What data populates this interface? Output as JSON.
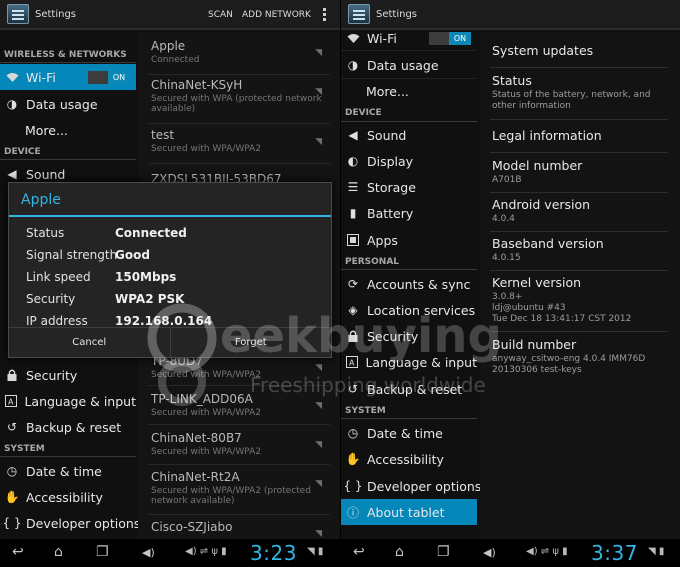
{
  "left": {
    "title": "Settings",
    "actions": {
      "scan": "SCAN",
      "add_network": "ADD NETWORK"
    },
    "categories": {
      "wireless": "WIRELESS & NETWORKS",
      "device": "DEVICE",
      "system": "SYSTEM"
    },
    "wifi_label": "Wi-Fi",
    "wifi_state": "ON",
    "items": {
      "data_usage": "Data usage",
      "more": "More...",
      "sound": "Sound",
      "security": "Security",
      "language": "Language & input",
      "backup": "Backup & reset",
      "datetime": "Date & time",
      "accessibility": "Accessibility",
      "developer": "Developer options"
    },
    "networks": [
      {
        "name": "Apple",
        "status": "Connected"
      },
      {
        "name": "ChinaNet-KSyH",
        "status": "Secured with WPA (protected network available)"
      },
      {
        "name": "test",
        "status": "Secured with WPA/WPA2"
      },
      {
        "name": "ZXDSL531BII-53BD67",
        "status": ""
      },
      {
        "name": "TP-8UD7",
        "status": "Secured with WPA/WPA2"
      },
      {
        "name": "TP-LINK_ADD06A",
        "status": "Secured with WPA/WPA2"
      },
      {
        "name": "ChinaNet-80B7",
        "status": "Secured with WPA/WPA2"
      },
      {
        "name": "ChinaNet-Rt2A",
        "status": "Secured with WPA/WPA2 (protected network available)"
      },
      {
        "name": "Cisco-SZJiabo",
        "status": ""
      }
    ],
    "dialog": {
      "title": "Apple",
      "rows": [
        {
          "label": "Status",
          "value": "Connected"
        },
        {
          "label": "Signal strength",
          "value": "Good"
        },
        {
          "label": "Link speed",
          "value": "150Mbps"
        },
        {
          "label": "Security",
          "value": "WPA2 PSK"
        },
        {
          "label": "IP address",
          "value": "192.168.0.164"
        }
      ],
      "cancel": "Cancel",
      "forget": "Forget"
    },
    "clock": "3:23"
  },
  "right": {
    "title": "Settings",
    "categories": {
      "device": "DEVICE",
      "personal": "PERSONAL",
      "system": "SYSTEM"
    },
    "wifi_label": "Wi-Fi",
    "wifi_state": "ON",
    "items": {
      "data_usage": "Data usage",
      "more": "More...",
      "sound": "Sound",
      "display": "Display",
      "storage": "Storage",
      "battery": "Battery",
      "apps": "Apps",
      "accounts": "Accounts & sync",
      "location": "Location services",
      "security": "Security",
      "language": "Language & input",
      "backup": "Backup & reset",
      "datetime": "Date & time",
      "accessibility": "Accessibility",
      "developer": "Developer options",
      "about": "About tablet"
    },
    "about": {
      "system_updates": "System updates",
      "status_title": "Status",
      "status_sub": "Status of the battery, network, and other information",
      "legal": "Legal information",
      "model_title": "Model number",
      "model_value": "A701B",
      "android_title": "Android version",
      "android_value": "4.0.4",
      "baseband_title": "Baseband version",
      "baseband_value": "4.0.15",
      "kernel_title": "Kernel version",
      "kernel_l1": "3.0.8+",
      "kernel_l2": "ldj@ubuntu #43",
      "kernel_l3": "Tue Dec 18 13:41:17 CST 2012",
      "build_title": "Build number",
      "build_l1": "anyway_csitwo-eng 4.0.4 IMM76D",
      "build_l2": "20130306 test-keys"
    },
    "clock": "3:37"
  },
  "watermark": {
    "brand": "eekbuying",
    "tagline": "Freeshipping worldwide"
  },
  "colors": {
    "accent": "#33b5e5",
    "selected": "#0587b9",
    "switch_on": "#0b89b4"
  }
}
